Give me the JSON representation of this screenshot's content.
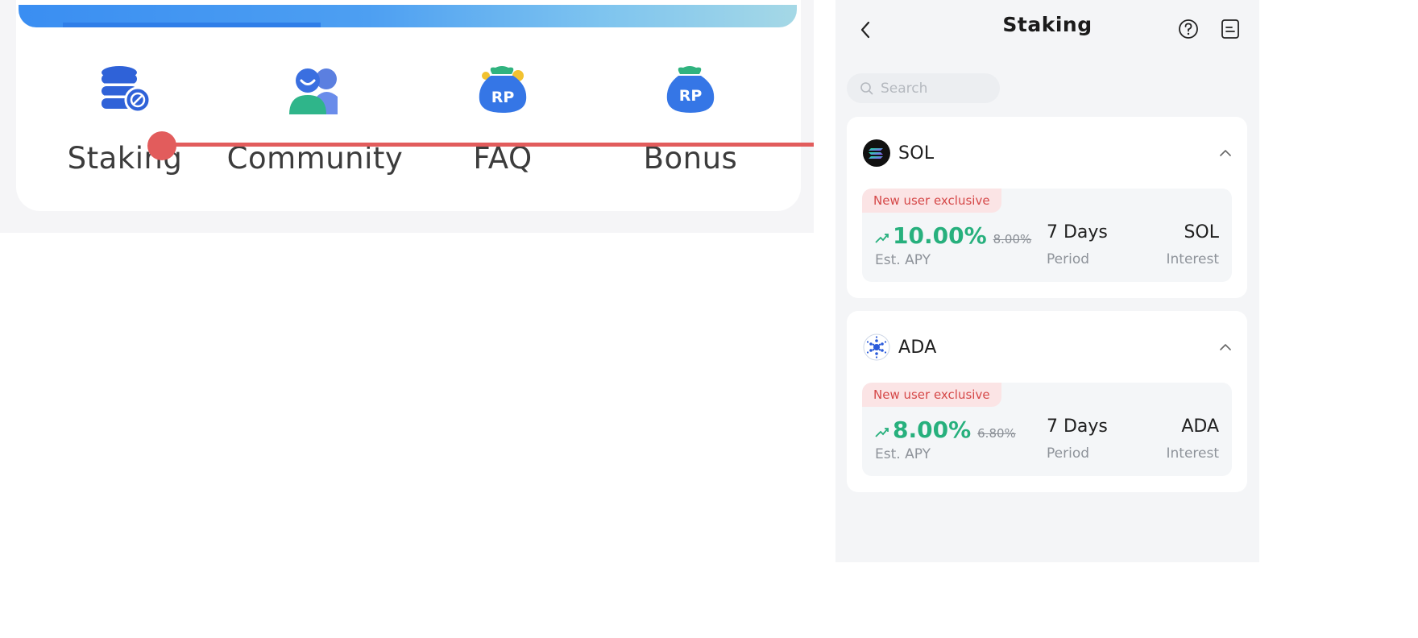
{
  "left": {
    "quick_menu": [
      {
        "label": "Staking",
        "icon": "database-coins-icon"
      },
      {
        "label": "Community",
        "icon": "community-people-icon"
      },
      {
        "label": "FAQ",
        "icon": "rp-money-bag-icon"
      },
      {
        "label": "Bonus",
        "icon": "rp-money-bag-icon"
      }
    ],
    "slider_color": "#e25c5c"
  },
  "phone": {
    "title": "Staking",
    "icons": {
      "back": "chevron-left-icon",
      "help": "question-circle-icon",
      "records": "document-list-icon"
    },
    "search": {
      "placeholder": "Search",
      "value": ""
    },
    "coins": [
      {
        "symbol": "SOL",
        "logo": "solana-logo-icon",
        "badge": "New user exclusive",
        "apy": "10.00%",
        "apy_old": "8.00%",
        "apy_label": "Est. APY",
        "period": "7 Days",
        "period_label": "Period",
        "interest": "SOL",
        "interest_label": "Interest"
      },
      {
        "symbol": "ADA",
        "logo": "cardano-logo-icon",
        "badge": "New user exclusive",
        "apy": "8.00%",
        "apy_old": "6.80%",
        "apy_label": "Est. APY",
        "period": "7 Days",
        "period_label": "Period",
        "interest": "ADA",
        "interest_label": "Interest"
      }
    ],
    "colors": {
      "positive": "#27b07d",
      "badge_text": "#d54848",
      "badge_bg": "#fbe4e5"
    }
  }
}
